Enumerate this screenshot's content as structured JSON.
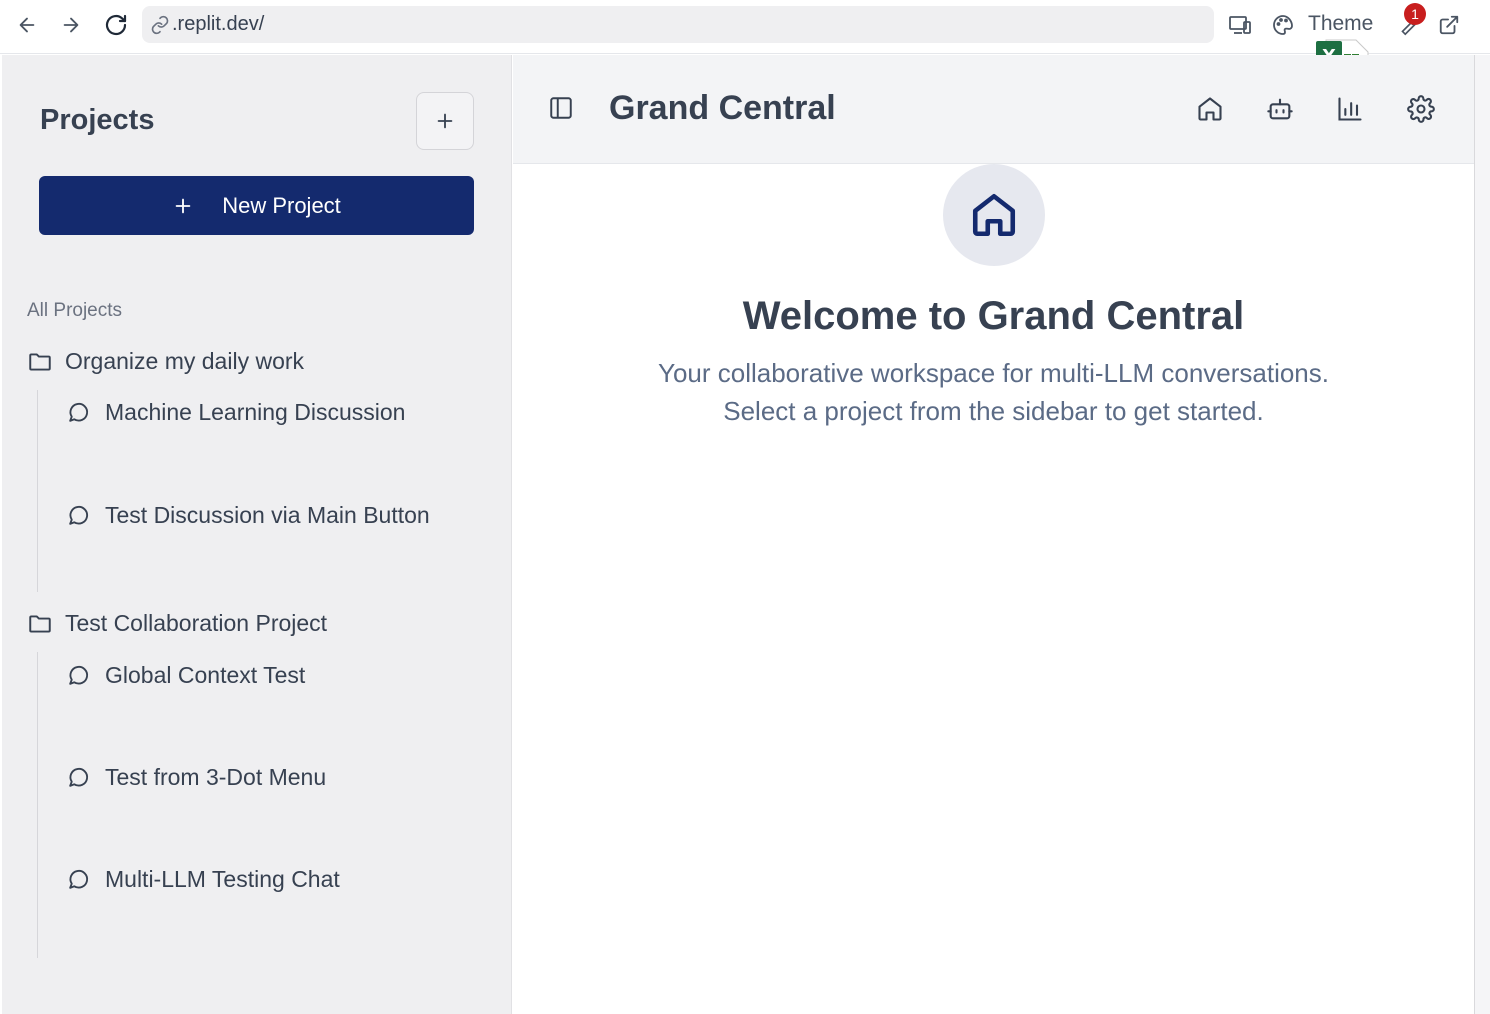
{
  "browser": {
    "url": ".replit.dev/",
    "theme_label": "Theme",
    "notification_count": "1"
  },
  "sidebar": {
    "title": "Projects",
    "new_project_label": "New Project",
    "section_label": "All Projects",
    "projects": [
      {
        "name": "Organize my daily work",
        "conversations": [
          "Machine Learning Discussion",
          "Test Discussion via Main Button"
        ]
      },
      {
        "name": "Test Collaboration Project",
        "conversations": [
          "Global Context Test",
          "Test from 3-Dot Menu",
          "Multi-LLM Testing Chat"
        ]
      }
    ]
  },
  "header": {
    "title": "Grand Central",
    "icons": [
      "home-icon",
      "bot-icon",
      "bar-chart-icon",
      "gear-icon"
    ]
  },
  "main": {
    "welcome_title": "Welcome to Grand Central",
    "subtitle_line1": "Your collaborative workspace for multi-LLM conversations.",
    "subtitle_line2": "Select a project from the sidebar to get started."
  },
  "colors": {
    "accent": "#142a6e",
    "sidebar_bg": "#efeff1",
    "badge": "#c81e1e"
  }
}
